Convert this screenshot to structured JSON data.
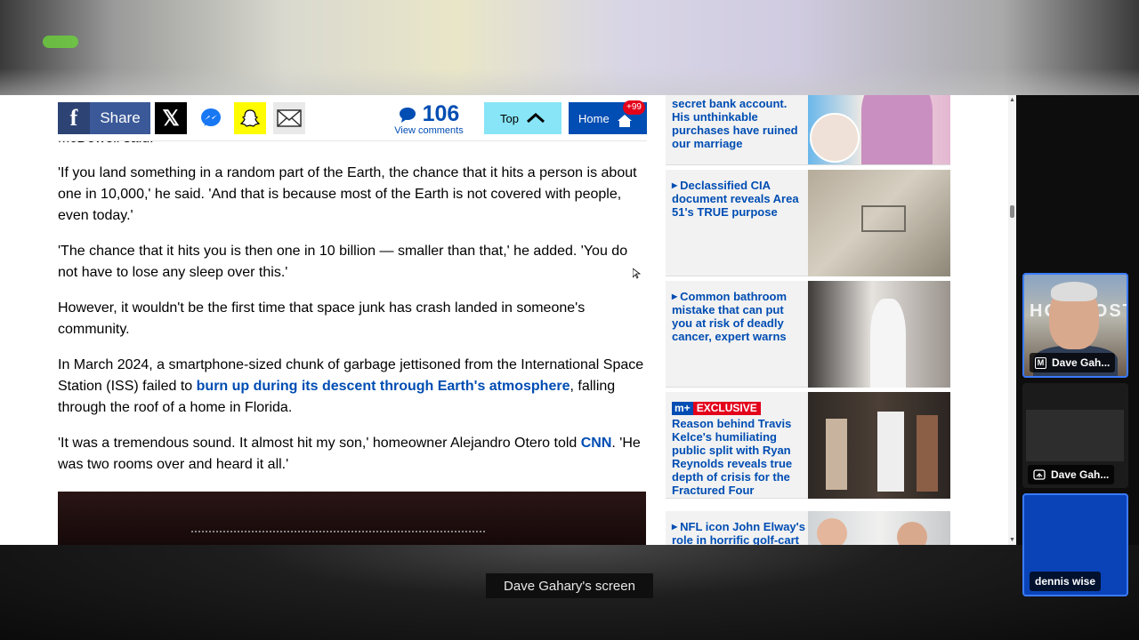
{
  "toolbar": {
    "share_label": "Share",
    "comment_count": "106",
    "comments_label": "View comments",
    "top_label": "Top",
    "home_label": "Home",
    "home_badge": "+99"
  },
  "article": {
    "cut_line": "McDowell said.",
    "p1": "'If you land something in a random part of the Earth, the chance that it hits a person is about one in 10,000,' he said. 'And that is because most of the Earth is not covered with people, even today.'",
    "p2": "'The chance that it hits you is then one in 10 billion — smaller than that,' he added. 'You do not have to lose any sleep over this.'",
    "p3": "However, it wouldn't be the first time that space junk has crash landed in someone's community.",
    "p4_before": "In March 2024, a smartphone-sized chunk of garbage jettisoned from the International Space Station (ISS) failed to ",
    "p4_link": "burn up during its descent through Earth's atmosphere",
    "p4_after": ", falling through the roof of a home in Florida.",
    "p5_before": "'It was a tremendous sound. It almost hit my son,' homeowner Alejandro Otero told ",
    "p5_link": "CNN",
    "p5_after": ". 'He was two rooms over and heard it all.'"
  },
  "sidebar": {
    "card1": "secret bank account. His unthinkable purchases have ruined our marriage",
    "card2": "Declassified CIA document reveals Area 51's TRUE purpose",
    "card3": "Common bathroom mistake that can put you at risk of deadly cancer, expert warns",
    "card4_mplus": "m+",
    "card4_exclusive": "EXCLUSIVE",
    "card4": "Reason behind Travis Kelce's humiliating public split with Ryan Reynolds reveals true depth of crisis for the Fractured Four",
    "card5": "NFL icon John Elway's role in horrific golf-cart"
  },
  "participants": {
    "p1_name": "Dave Gah...",
    "p1_icon": "M",
    "p2_name": "Dave Gah...",
    "p3_name": "dennis wise"
  },
  "screen_label": "Dave Gahary's screen"
}
